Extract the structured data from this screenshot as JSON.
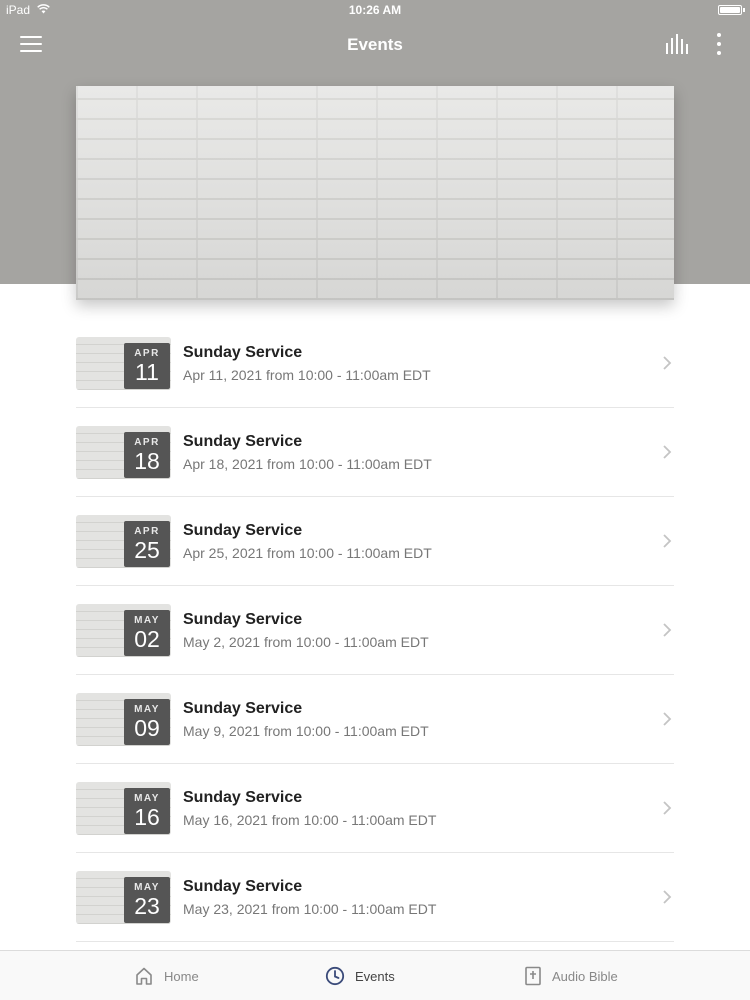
{
  "status_bar": {
    "carrier": "iPad",
    "time": "10:26 AM"
  },
  "header": {
    "title": "Events"
  },
  "events": [
    {
      "month": "APR",
      "day": "11",
      "title": "Sunday Service",
      "subtitle": "Apr 11, 2021 from 10:00 - 11:00am EDT"
    },
    {
      "month": "APR",
      "day": "18",
      "title": "Sunday Service",
      "subtitle": "Apr 18, 2021 from 10:00 - 11:00am EDT"
    },
    {
      "month": "APR",
      "day": "25",
      "title": "Sunday Service",
      "subtitle": "Apr 25, 2021 from 10:00 - 11:00am EDT"
    },
    {
      "month": "MAY",
      "day": "02",
      "title": "Sunday Service",
      "subtitle": "May 2, 2021 from 10:00 - 11:00am EDT"
    },
    {
      "month": "MAY",
      "day": "09",
      "title": "Sunday Service",
      "subtitle": "May 9, 2021 from 10:00 - 11:00am EDT"
    },
    {
      "month": "MAY",
      "day": "16",
      "title": "Sunday Service",
      "subtitle": "May 16, 2021 from 10:00 - 11:00am EDT"
    },
    {
      "month": "MAY",
      "day": "23",
      "title": "Sunday Service",
      "subtitle": "May 23, 2021 from 10:00 - 11:00am EDT"
    }
  ],
  "tabs": [
    {
      "label": "Home",
      "icon": "home-icon"
    },
    {
      "label": "Events",
      "icon": "clock-icon"
    },
    {
      "label": "Audio Bible",
      "icon": "bible-icon"
    }
  ],
  "colors": {
    "header_bg": "#a5a4a1",
    "badge_bg": "#555555",
    "active_tab": "#444444"
  }
}
